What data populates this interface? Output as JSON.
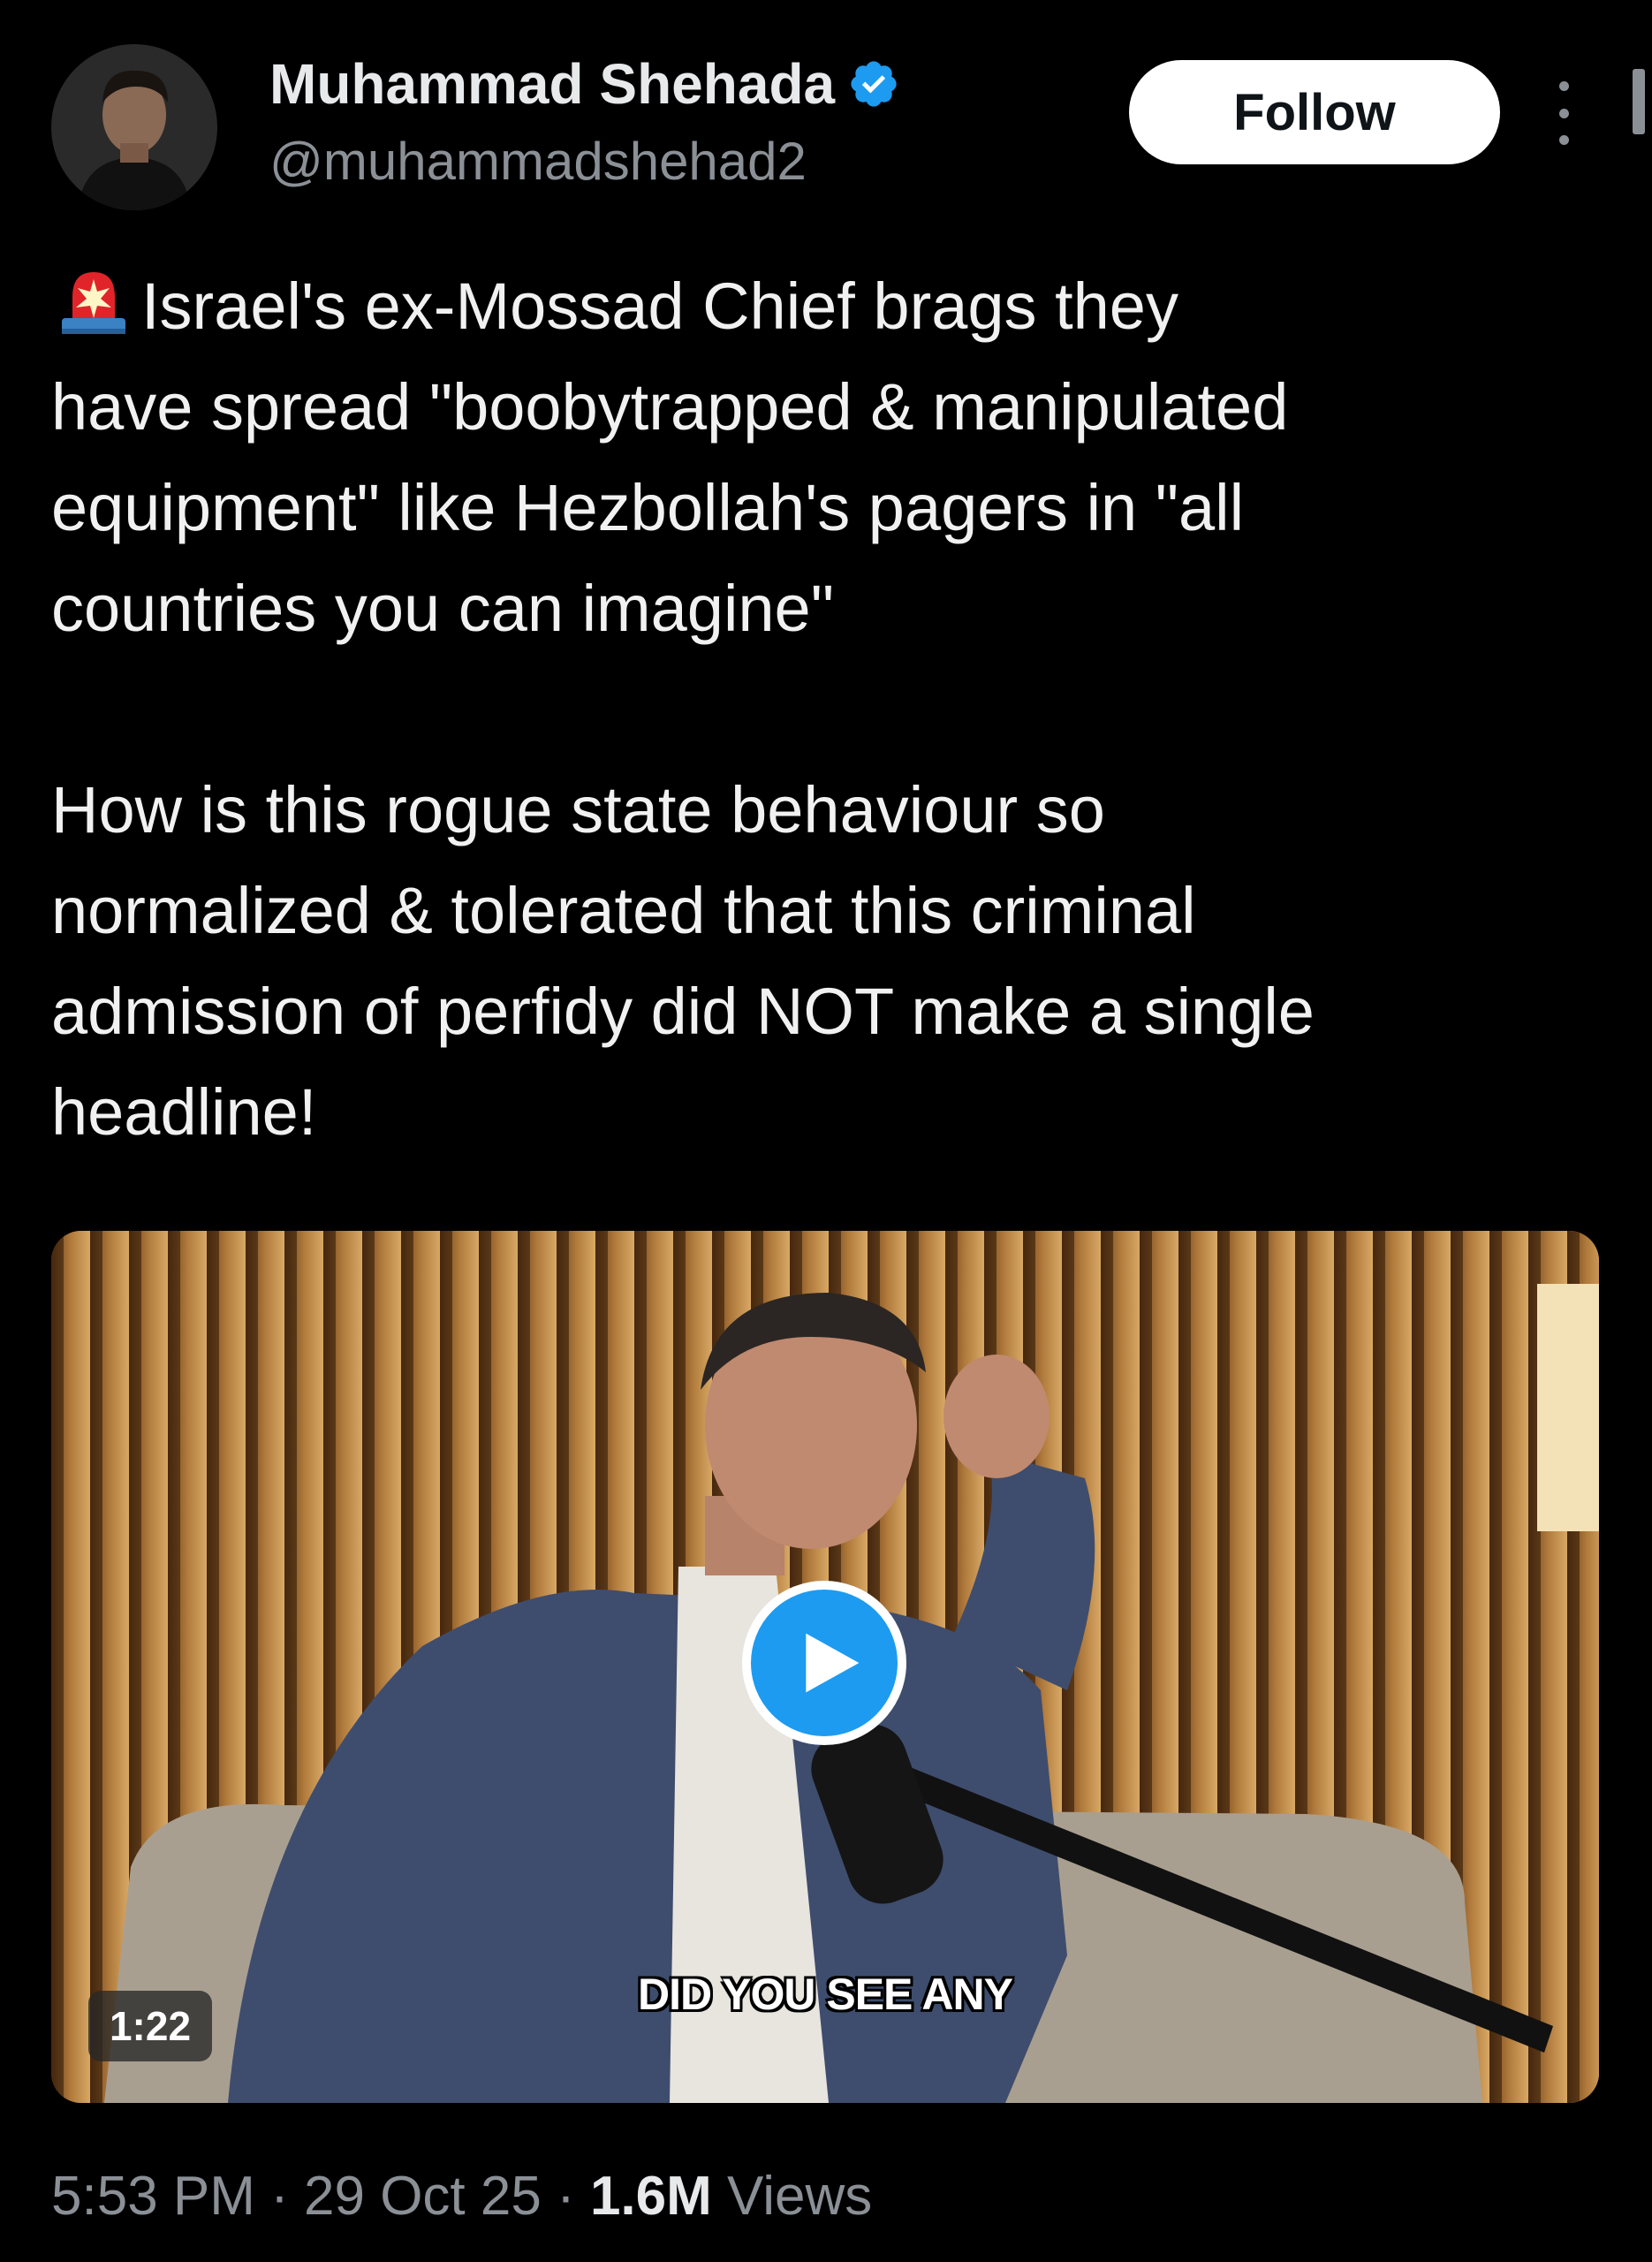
{
  "author": {
    "display_name": "Muhammad Shehada",
    "handle": "@muhammadshehad2",
    "verified": true,
    "avatar_icon": "avatar-photo",
    "verified_icon": "verified-badge-icon"
  },
  "header": {
    "follow_label": "Follow",
    "more_icon": "more-vertical-icon"
  },
  "tweet": {
    "emoji": "siren-icon",
    "paragraph_1": "Israel's ex-Mossad Chief brags they\nhave spread \"boobytrapped & manipulated\nequipment\" like Hezbollah's pagers in \"all\ncountries you can imagine\"",
    "paragraph_2": "How is this rogue state behaviour so\nnormalized & tolerated that this criminal\nadmission of perfidy did NOT make a single\nheadline!"
  },
  "media": {
    "type": "video",
    "caption": "DID YOU SEE ANY",
    "duration": "1:22",
    "play_icon": "play-icon"
  },
  "meta": {
    "time": "5:53 PM",
    "date": "29 Oct 25",
    "separator": " · ",
    "views_count": "1.6M",
    "views_label": "Views"
  },
  "colors": {
    "background": "#000000",
    "text_primary": "#e7e9ea",
    "text_secondary": "#8b9096",
    "accent": "#1d9bf0"
  }
}
